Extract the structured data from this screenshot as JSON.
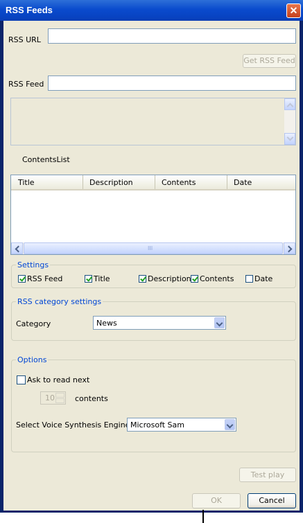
{
  "window": {
    "title": "RSS Feeds",
    "close_glyph": "✕"
  },
  "rss_url": {
    "label": "RSS URL",
    "value": ""
  },
  "get_feed_button": "Get RSS Feed",
  "rss_feed": {
    "label": "RSS Feed",
    "value": ""
  },
  "feed_text": "",
  "contents_list": {
    "label": "ContentsList",
    "columns": [
      "Title",
      "Description",
      "Contents",
      "Date"
    ],
    "scrollbar_grip": "III"
  },
  "settings": {
    "legend": "Settings",
    "checkboxes": [
      {
        "label": "RSS Feed",
        "checked": true
      },
      {
        "label": "Title",
        "checked": true
      },
      {
        "label": "Description",
        "checked": true
      },
      {
        "label": "Contents",
        "checked": true
      },
      {
        "label": "Date",
        "checked": false
      }
    ]
  },
  "category_settings": {
    "legend": "RSS category settings",
    "label": "Category",
    "value": "News"
  },
  "options": {
    "legend": "Options",
    "ask_next_label": "Ask to read next",
    "ask_next_checked": false,
    "count_value": "10",
    "count_unit": "contents",
    "engine_label": "Select Voice Synthesis Engine",
    "engine_value": "Microsoft Sam"
  },
  "test_play_button": "Test play",
  "ok_button": "OK",
  "cancel_button": "Cancel"
}
